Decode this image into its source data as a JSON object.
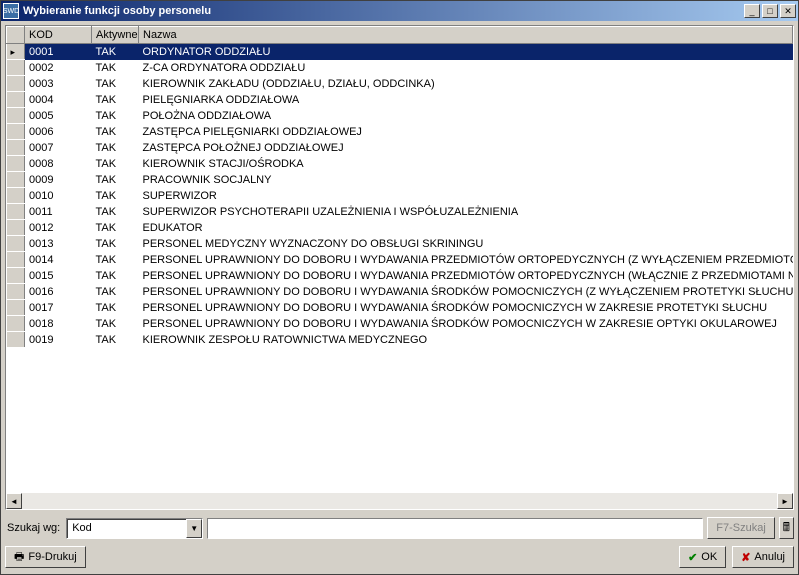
{
  "window": {
    "title": "Wybieranie funkcji osoby personelu",
    "icon_text": "SWD"
  },
  "columns": {
    "kod": "KOD",
    "aktywne": "Aktywne",
    "nazwa": "Nazwa"
  },
  "rows": [
    {
      "kod": "0001",
      "akt": "TAK",
      "nazwa": "ORDYNATOR ODDZIAŁU"
    },
    {
      "kod": "0002",
      "akt": "TAK",
      "nazwa": "Z-CA ORDYNATORA ODDZIAŁU"
    },
    {
      "kod": "0003",
      "akt": "TAK",
      "nazwa": "KIEROWNIK ZAKŁADU (ODDZIAŁU, DZIAŁU, ODDCINKA)"
    },
    {
      "kod": "0004",
      "akt": "TAK",
      "nazwa": "PIELĘGNIARKA ODDZIAŁOWA"
    },
    {
      "kod": "0005",
      "akt": "TAK",
      "nazwa": "POŁOŻNA ODDZIAŁOWA"
    },
    {
      "kod": "0006",
      "akt": "TAK",
      "nazwa": "ZASTĘPCA PIELĘGNIARKI ODDZIAŁOWEJ"
    },
    {
      "kod": "0007",
      "akt": "TAK",
      "nazwa": "ZASTĘPCA POŁOŻNEJ ODDZIAŁOWEJ"
    },
    {
      "kod": "0008",
      "akt": "TAK",
      "nazwa": "KIEROWNIK STACJI/OŚRODKA"
    },
    {
      "kod": "0009",
      "akt": "TAK",
      "nazwa": "PRACOWNIK SOCJALNY"
    },
    {
      "kod": "0010",
      "akt": "TAK",
      "nazwa": "SUPERWIZOR"
    },
    {
      "kod": "0011",
      "akt": "TAK",
      "nazwa": "SUPERWIZOR PSYCHOTERAPII UZALEŻNIENIA I WSPÓŁUZALEŻNIENIA"
    },
    {
      "kod": "0012",
      "akt": "TAK",
      "nazwa": "EDUKATOR"
    },
    {
      "kod": "0013",
      "akt": "TAK",
      "nazwa": "PERSONEL MEDYCZNY WYZNACZONY DO OBSŁUGI SKRININGU"
    },
    {
      "kod": "0014",
      "akt": "TAK",
      "nazwa": "PERSONEL UPRAWNIONY DO DOBORU I WYDAWANIA PRZEDMIOTÓW ORTOPEDYCZNYCH (Z WYŁĄCZENIEM PRZEDMIOTÓW"
    },
    {
      "kod": "0015",
      "akt": "TAK",
      "nazwa": "PERSONEL UPRAWNIONY DO DOBORU I WYDAWANIA PRZEDMIOTÓW ORTOPEDYCZNYCH (WŁĄCZNIE Z  PRZEDMIOTAMI NA"
    },
    {
      "kod": "0016",
      "akt": "TAK",
      "nazwa": "PERSONEL UPRAWNIONY DO DOBORU I WYDAWANIA ŚRODKÓW POMOCNICZYCH (Z WYŁĄCZENIEM PROTETYKI SŁUCHU I O"
    },
    {
      "kod": "0017",
      "akt": "TAK",
      "nazwa": "PERSONEL UPRAWNIONY DO DOBORU I WYDAWANIA ŚRODKÓW POMOCNICZYCH W ZAKRESIE PROTETYKI SŁUCHU"
    },
    {
      "kod": "0018",
      "akt": "TAK",
      "nazwa": "PERSONEL UPRAWNIONY DO DOBORU I WYDAWANIA ŚRODKÓW POMOCNICZYCH W ZAKRESIE OPTYKI OKULAROWEJ"
    },
    {
      "kod": "0019",
      "akt": "TAK",
      "nazwa": "KIEROWNIK ZESPOŁU RATOWNICTWA MEDYCZNEGO"
    }
  ],
  "selected_index": 0,
  "search": {
    "label": "Szukaj wg:",
    "combo_value": "Kod",
    "input_value": "",
    "button": "F7-Szukaj"
  },
  "buttons": {
    "print": "F9-Drukuj",
    "ok": "OK",
    "cancel": "Anuluj"
  }
}
